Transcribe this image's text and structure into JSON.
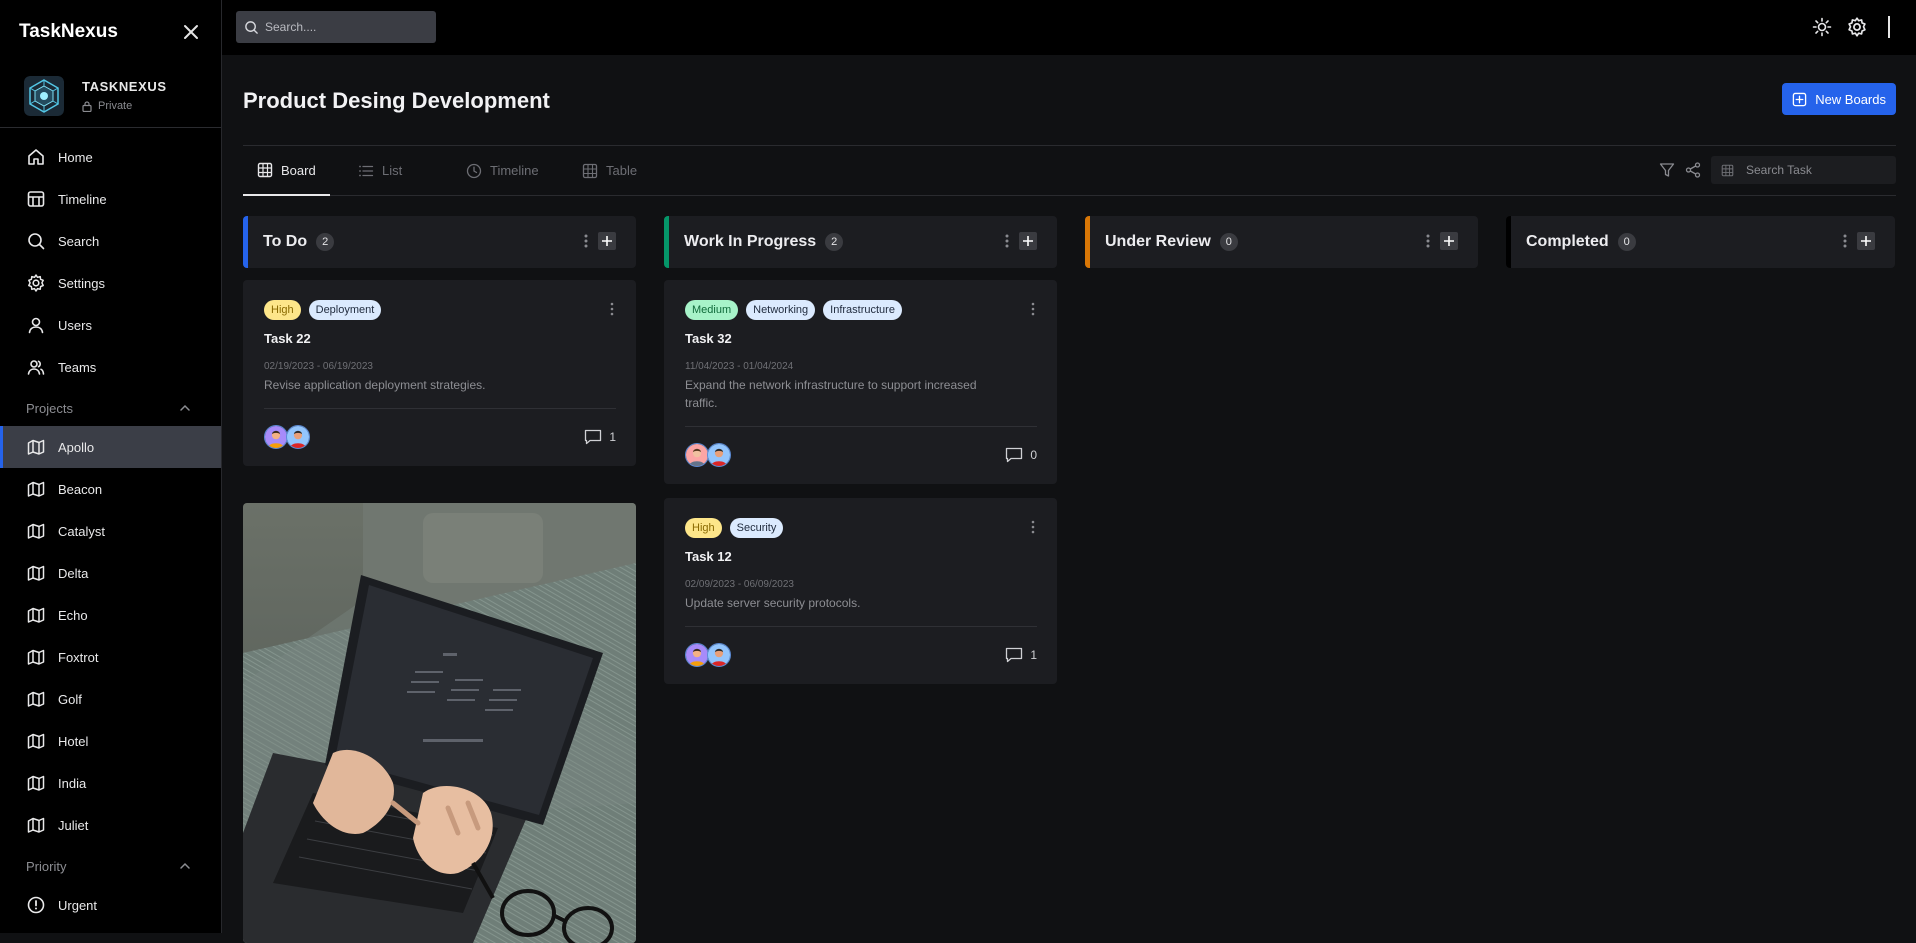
{
  "app": {
    "name": "TaskNexus"
  },
  "workspace": {
    "name": "TASKNEXUS",
    "visibility": "Private"
  },
  "sidebar": {
    "nav": [
      {
        "label": "Home",
        "icon": "home-icon"
      },
      {
        "label": "Timeline",
        "icon": "timeline-icon"
      },
      {
        "label": "Search",
        "icon": "search-icon"
      },
      {
        "label": "Settings",
        "icon": "gear-icon"
      },
      {
        "label": "Users",
        "icon": "user-icon"
      },
      {
        "label": "Teams",
        "icon": "teams-icon"
      }
    ],
    "projects_heading": "Projects",
    "projects": [
      "Apollo",
      "Beacon",
      "Catalyst",
      "Delta",
      "Echo",
      "Foxtrot",
      "Golf",
      "Hotel",
      "India",
      "Juliet"
    ],
    "active_project": "Apollo",
    "priority_heading": "Priority",
    "priority": [
      {
        "label": "Urgent",
        "icon": "alert-circle-icon"
      }
    ]
  },
  "topbar": {
    "search_placeholder": "Search...."
  },
  "page": {
    "title": "Product Desing Development",
    "new_button": "New Boards",
    "tabs": [
      "Board",
      "List",
      "Timeline",
      "Table"
    ],
    "active_tab": "Board",
    "task_search_placeholder": "Search Task"
  },
  "columns": [
    {
      "title": "To Do",
      "count": "2",
      "color": "#2563eb",
      "cards": [
        {
          "tags": [
            {
              "label": "High",
              "kind": "high"
            },
            {
              "label": "Deployment",
              "kind": "cat"
            }
          ],
          "title": "Task 22",
          "dates": "02/19/2023 - 06/19/2023",
          "desc": "Revise application deployment strategies.",
          "comments": "1"
        }
      ]
    },
    {
      "title": "Work In Progress",
      "count": "2",
      "color": "#059669",
      "cards": [
        {
          "tags": [
            {
              "label": "Medium",
              "kind": "medium"
            },
            {
              "label": "Networking",
              "kind": "cat"
            },
            {
              "label": "Infrastructure",
              "kind": "cat"
            }
          ],
          "title": "Task 32",
          "dates": "11/04/2023 - 01/04/2024",
          "desc": "Expand the network infrastructure to support increased traffic.",
          "comments": "0"
        },
        {
          "tags": [
            {
              "label": "High",
              "kind": "high"
            },
            {
              "label": "Security",
              "kind": "cat"
            }
          ],
          "title": "Task 12",
          "dates": "02/09/2023 - 06/09/2023",
          "desc": "Update server security protocols.",
          "comments": "1"
        }
      ]
    },
    {
      "title": "Under Review",
      "count": "0",
      "color": "#d97706",
      "cards": []
    },
    {
      "title": "Completed",
      "count": "0",
      "color": "#000000",
      "cards": []
    }
  ]
}
